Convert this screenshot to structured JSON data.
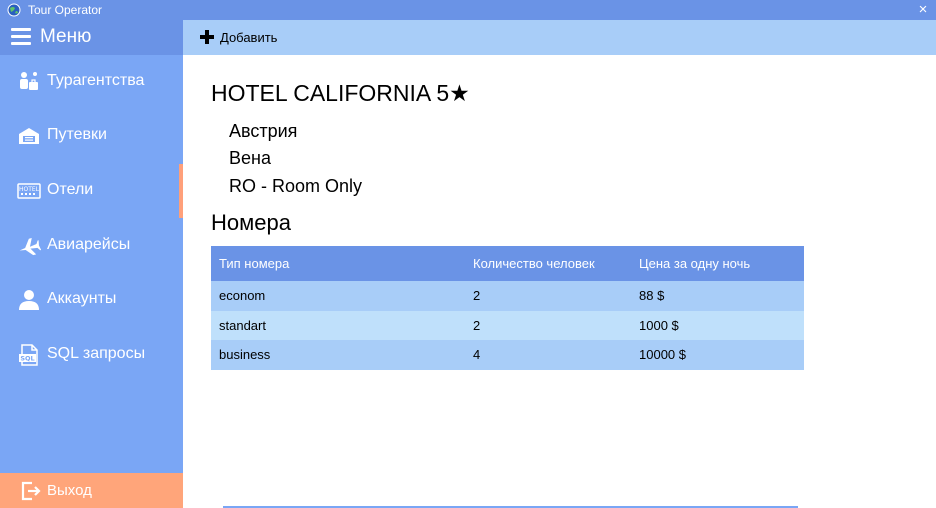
{
  "window": {
    "title": "Tour Operator",
    "close_glyph": "×",
    "app_icon": "globe-icon"
  },
  "sidebar": {
    "menu_label": "Меню",
    "items": [
      {
        "label": "Турагентства",
        "icon": "agency-icon",
        "active": false
      },
      {
        "label": "Путевки",
        "icon": "tickets-icon",
        "active": false
      },
      {
        "label": "Отели",
        "icon": "hotel-icon",
        "active": true
      },
      {
        "label": "Авиарейсы",
        "icon": "airplane-icon",
        "active": false
      },
      {
        "label": "Аккаунты",
        "icon": "user-icon",
        "active": false
      },
      {
        "label": "SQL запросы",
        "icon": "sql-file-icon",
        "active": false
      }
    ],
    "logout_label": "Выход"
  },
  "toolbar": {
    "add_label": "Добавить"
  },
  "hotel": {
    "name": "HOTEL CALIFORNIA 5★",
    "country": "Австрия",
    "city": "Вена",
    "board": "RO - Room Only"
  },
  "rooms": {
    "heading": "Номера",
    "columns": [
      "Тип номера",
      "Количество человек",
      "Цена за одну ночь"
    ],
    "rows": [
      [
        "econom",
        "2",
        "88 $"
      ],
      [
        "standart",
        "2",
        "1000 $"
      ],
      [
        "business",
        "4",
        "10000 $"
      ]
    ]
  },
  "colors": {
    "title_bar": "#6a93e6",
    "sidebar": "#7aa6f5",
    "active_indicator": "#ffa07a",
    "logout": "#ffa57a",
    "toolbar": "#a8cdf8",
    "table_header": "#6a93e6",
    "row_odd": "#a8cdf8",
    "row_even": "#bfe0fb"
  }
}
